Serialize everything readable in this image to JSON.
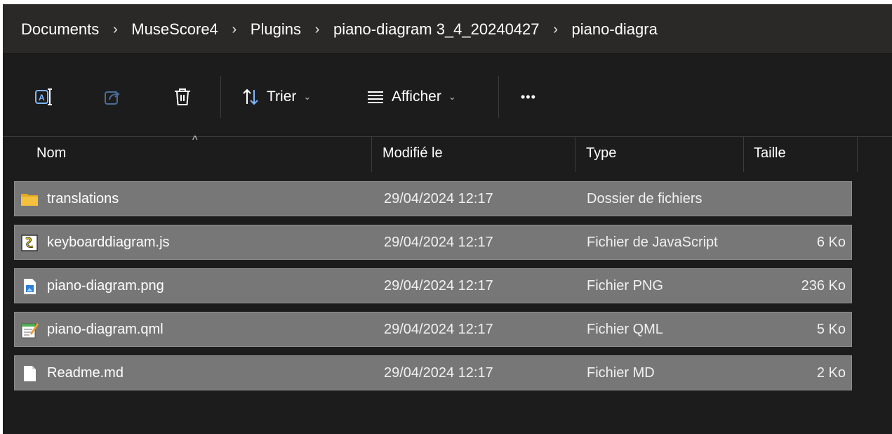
{
  "breadcrumb": {
    "items": [
      "Documents",
      "MuseScore4",
      "Plugins",
      "piano-diagram 3_4_20240427",
      "piano-diagra"
    ],
    "separator": "›"
  },
  "toolbar": {
    "sort_label": "Trier",
    "view_label": "Afficher",
    "more_label": "•••"
  },
  "columns": {
    "name": "Nom",
    "modified": "Modifié le",
    "type": "Type",
    "size": "Taille"
  },
  "files": [
    {
      "name": "translations",
      "modified": "29/04/2024 12:17",
      "type": "Dossier de fichiers",
      "size": "",
      "icon": "folder-icon"
    },
    {
      "name": "keyboarddiagram.js",
      "modified": "29/04/2024 12:17",
      "type": "Fichier de JavaScript",
      "size": "6 Ko",
      "icon": "javascript-file-icon"
    },
    {
      "name": "piano-diagram.png",
      "modified": "29/04/2024 12:17",
      "type": "Fichier PNG",
      "size": "236 Ko",
      "icon": "image-file-icon"
    },
    {
      "name": "piano-diagram.qml",
      "modified": "29/04/2024 12:17",
      "type": "Fichier QML",
      "size": "5 Ko",
      "icon": "qml-file-icon"
    },
    {
      "name": "Readme.md",
      "modified": "29/04/2024 12:17",
      "type": "Fichier MD",
      "size": "2 Ko",
      "icon": "text-file-icon"
    }
  ],
  "colors": {
    "background": "#1c1c1c",
    "address_bar": "#2b2927",
    "selected_row": "#777777",
    "folder": "#f4c13f"
  }
}
